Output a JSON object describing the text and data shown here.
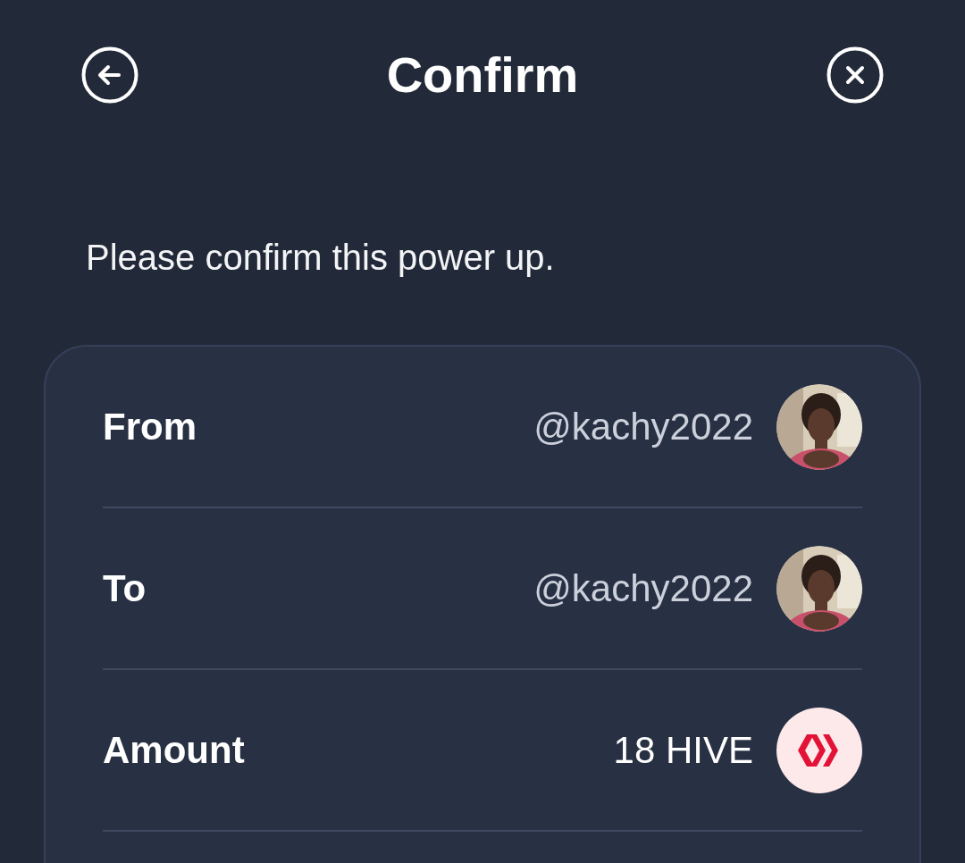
{
  "header": {
    "title": "Confirm"
  },
  "message": "Please confirm this power up.",
  "rows": [
    {
      "label": "From",
      "value": "@kachy2022",
      "kind": "avatar"
    },
    {
      "label": "To",
      "value": "@kachy2022",
      "kind": "avatar"
    },
    {
      "label": "Amount",
      "value": "18 HIVE",
      "kind": "token"
    }
  ]
}
